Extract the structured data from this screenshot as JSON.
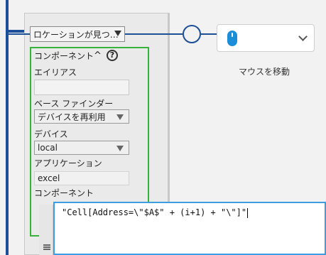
{
  "flow": {
    "location_dropdown": "ロケーションが見つ…",
    "action_card": {
      "icon": "mouse-icon",
      "label": "マウスを移動"
    }
  },
  "component_panel": {
    "header_label": "コンポーネント",
    "collapse_icon": "^",
    "help_icon": "?",
    "alias": {
      "label": "エイリアス",
      "value": ""
    },
    "base_finder": {
      "label": "ベース ファインダー",
      "selected": "デバイスを再利用"
    },
    "device": {
      "label": "デバイス",
      "selected": "local"
    },
    "application": {
      "label": "アプリケーション",
      "value": "excel"
    },
    "component": {
      "label": "コンポーネント"
    }
  },
  "editor": {
    "code": "\"Cell[Address=\\\"$A$\" + (i+1) + \"\\\"]\""
  },
  "colors": {
    "flow_line": "#1d4f99",
    "green_border": "#35b33b",
    "editor_border": "#3e9de0",
    "mouse_icon": "#1c8dd8"
  }
}
